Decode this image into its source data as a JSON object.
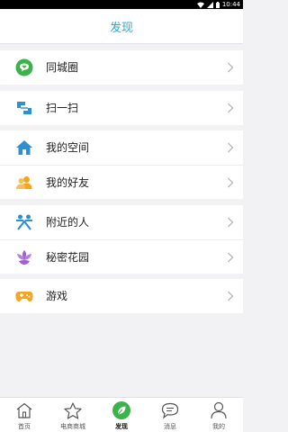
{
  "statusbar": {
    "time": "10:44"
  },
  "header": {
    "title": "发现"
  },
  "groups": [
    {
      "items": [
        {
          "label": "同城圈",
          "icon": "chat-bubble-heart-icon",
          "color": "#3cb34a"
        }
      ]
    },
    {
      "items": [
        {
          "label": "扫一扫",
          "icon": "scan-icon",
          "color": "#2d8fd4"
        }
      ]
    },
    {
      "items": [
        {
          "label": "我的空间",
          "icon": "home-icon",
          "color": "#2d8fd4"
        },
        {
          "label": "我的好友",
          "icon": "friends-icon",
          "color": "#f3a623"
        }
      ]
    },
    {
      "items": [
        {
          "label": "附近的人",
          "icon": "nearby-people-icon",
          "color": "#2d8fd4"
        },
        {
          "label": "秘密花园",
          "icon": "lotus-icon",
          "color": "#a25ed6"
        }
      ]
    },
    {
      "items": [
        {
          "label": "游戏",
          "icon": "gamepad-icon",
          "color": "#f3a623"
        }
      ]
    }
  ],
  "tabbar": {
    "tabs": [
      {
        "label": "首页",
        "icon": "home-outline-icon"
      },
      {
        "label": "电商商城",
        "icon": "star-outline-icon"
      },
      {
        "label": "发现",
        "icon": "discover-leaf-icon",
        "active": true
      },
      {
        "label": "消息",
        "icon": "message-bubble-icon"
      },
      {
        "label": "我的",
        "icon": "user-outline-icon"
      }
    ],
    "active_color": "#3cb34a"
  },
  "colors": {
    "accent": "#2aa8dc",
    "background": "#f2f2f4"
  }
}
